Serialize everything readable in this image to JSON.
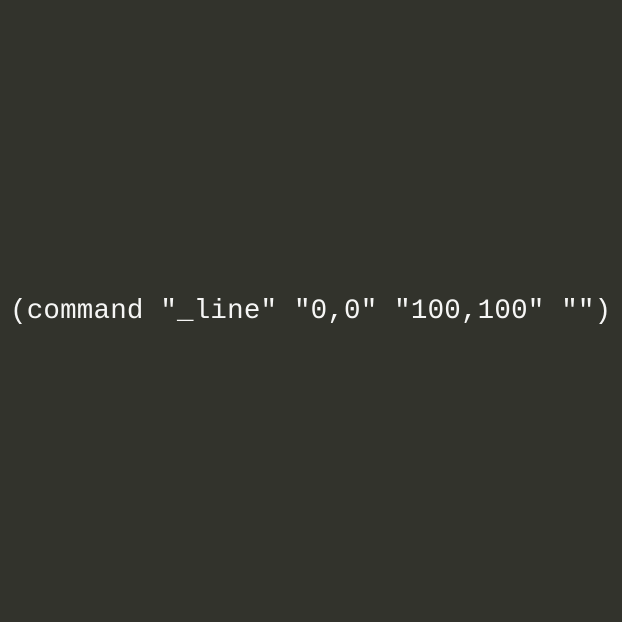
{
  "code": {
    "line": "(command \"_line\" \"0,0\" \"100,100\" \"\")"
  }
}
